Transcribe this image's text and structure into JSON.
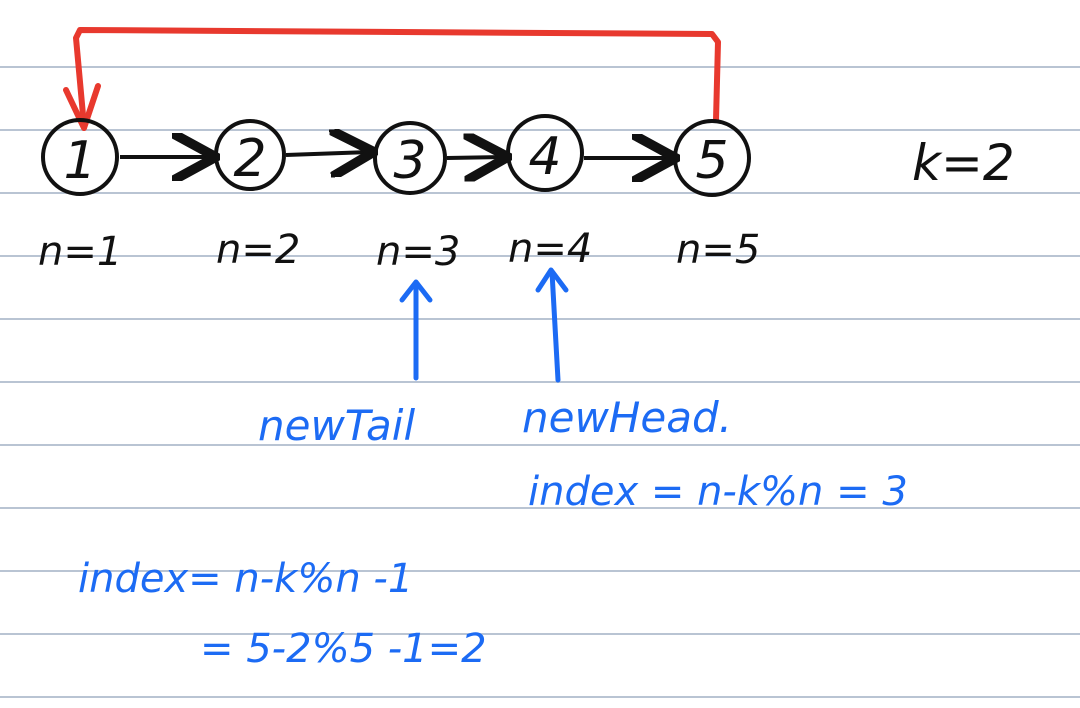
{
  "colors": {
    "ink": "#111111",
    "wrap_arrow": "#e8392e",
    "annotation": "#1c6bf4",
    "ruled_line": "#b9c4d3"
  },
  "nodes": [
    {
      "value": "1",
      "label": "n=1"
    },
    {
      "value": "2",
      "label": "n=2"
    },
    {
      "value": "3",
      "label": "n=3"
    },
    {
      "value": "4",
      "label": "n=4"
    },
    {
      "value": "5",
      "label": "n=5"
    }
  ],
  "k_label": "k=2",
  "annotations": {
    "new_tail": "newTail",
    "new_head": "newHead.",
    "index_formula_head": "index = n-k%n = 3",
    "index_formula_tail": "index= n-k%n -1",
    "index_calc": "= 5-2%5 -1=2"
  }
}
